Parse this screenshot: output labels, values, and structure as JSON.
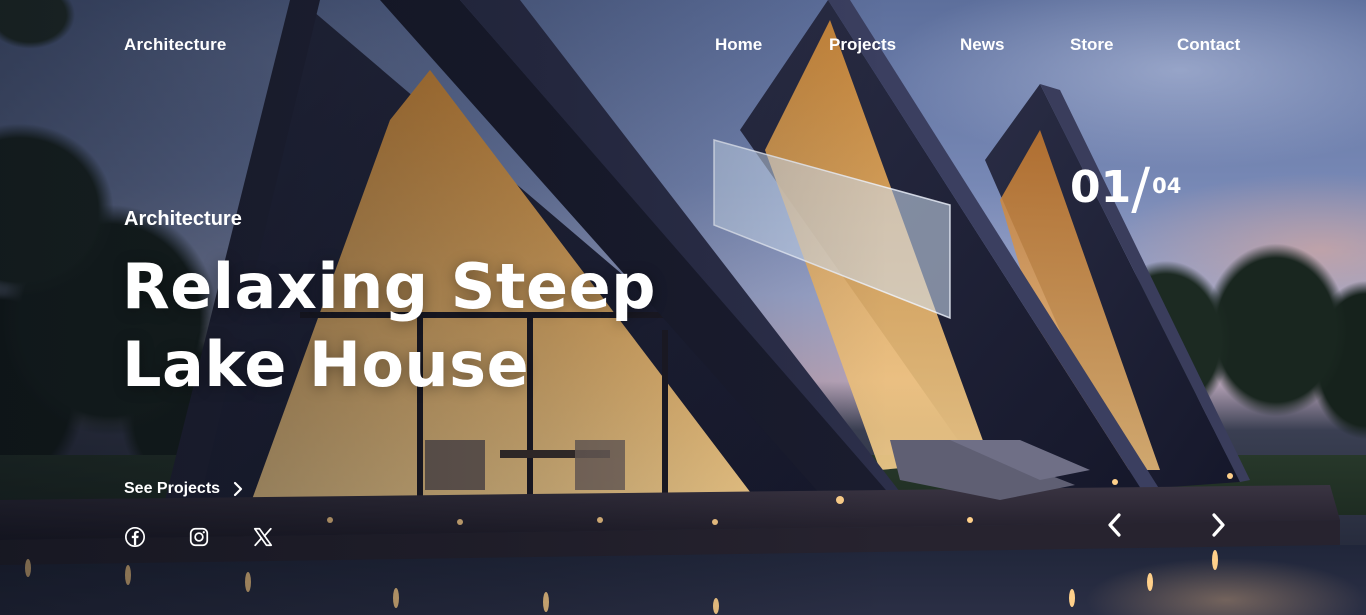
{
  "header": {
    "brand": "Architecture",
    "nav": [
      {
        "label": "Home"
      },
      {
        "label": "Projects"
      },
      {
        "label": "News"
      },
      {
        "label": "Store"
      },
      {
        "label": "Contact"
      }
    ]
  },
  "hero": {
    "kicker": "Architecture",
    "title_line1": "Relaxing Steep",
    "title_line2": "Lake House",
    "cta_label": "See Projects",
    "cta_icon": "chevron-right-icon"
  },
  "social": [
    {
      "name": "facebook",
      "icon": "facebook-icon"
    },
    {
      "name": "instagram",
      "icon": "instagram-icon"
    },
    {
      "name": "x",
      "icon": "x-icon"
    }
  ],
  "slider": {
    "current": "01",
    "separator": "/",
    "total": "04",
    "prev_icon": "chevron-left-icon",
    "next_icon": "chevron-right-icon"
  },
  "colors": {
    "text": "#ffffff",
    "sky_top": "#5d6f9c",
    "roof": "#1a1c2e",
    "window_glow": "#f3b96a",
    "deck": "#2a2532"
  }
}
